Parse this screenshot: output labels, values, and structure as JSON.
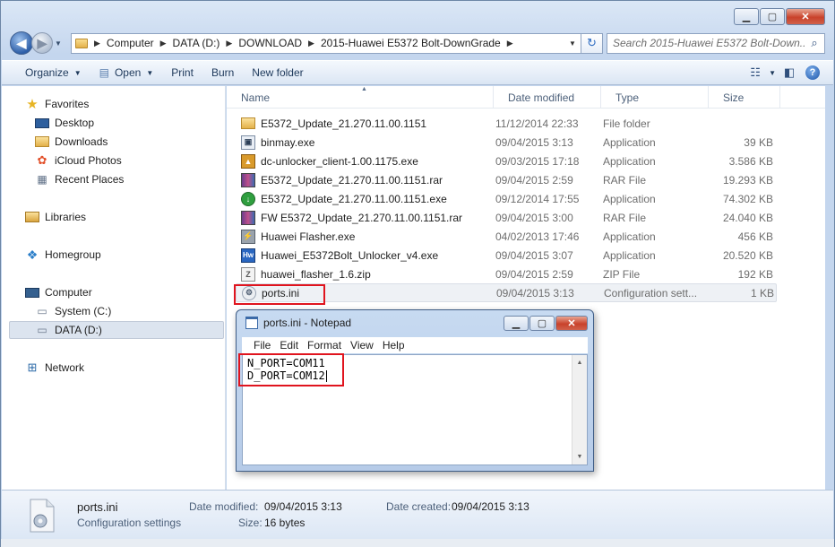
{
  "address": {
    "crumbs": [
      "Computer",
      "DATA (D:)",
      "DOWNLOAD",
      "2015-Huawei E5372 Bolt-DownGrade"
    ],
    "search_placeholder": "Search 2015-Huawei E5372 Bolt-Down..."
  },
  "toolbar": {
    "organize": "Organize",
    "open": "Open",
    "print": "Print",
    "burn": "Burn",
    "new_folder": "New folder"
  },
  "nav": {
    "favorites": "Favorites",
    "desktop": "Desktop",
    "downloads": "Downloads",
    "icloud": "iCloud Photos",
    "recent": "Recent Places",
    "libraries": "Libraries",
    "homegroup": "Homegroup",
    "computer": "Computer",
    "system": "System (C:)",
    "data": "DATA (D:)",
    "network": "Network"
  },
  "columns": {
    "name": "Name",
    "date": "Date modified",
    "type": "Type",
    "size": "Size"
  },
  "files": [
    {
      "name": "E5372_Update_21.270.11.00.1151",
      "date": "11/12/2014 22:33",
      "type": "File folder",
      "size": "",
      "icon": "folder-icon"
    },
    {
      "name": "binmay.exe",
      "date": "09/04/2015 3:13",
      "type": "Application",
      "size": "39 KB",
      "icon": "exe-icon"
    },
    {
      "name": "dc-unlocker_client-1.00.1175.exe",
      "date": "09/03/2015 17:18",
      "type": "Application",
      "size": "3.586 KB",
      "icon": "dc-unlocker-icon"
    },
    {
      "name": "E5372_Update_21.270.11.00.1151.rar",
      "date": "09/04/2015 2:59",
      "type": "RAR File",
      "size": "19.293 KB",
      "icon": "rar-icon"
    },
    {
      "name": "E5372_Update_21.270.11.00.1151.exe",
      "date": "09/12/2014 17:55",
      "type": "Application",
      "size": "74.302 KB",
      "icon": "update-icon"
    },
    {
      "name": "FW E5372_Update_21.270.11.00.1151.rar",
      "date": "09/04/2015 3:00",
      "type": "RAR File",
      "size": "24.040 KB",
      "icon": "rar-icon"
    },
    {
      "name": "Huawei Flasher.exe",
      "date": "04/02/2013 17:46",
      "type": "Application",
      "size": "456 KB",
      "icon": "flasher-icon"
    },
    {
      "name": "Huawei_E5372Bolt_Unlocker_v4.exe",
      "date": "09/04/2015 3:07",
      "type": "Application",
      "size": "20.520 KB",
      "icon": "hw-icon"
    },
    {
      "name": "huawei_flasher_1.6.zip",
      "date": "09/04/2015 2:59",
      "type": "ZIP File",
      "size": "192 KB",
      "icon": "zip-icon"
    },
    {
      "name": "ports.ini",
      "date": "09/04/2015 3:13",
      "type": "Configuration sett...",
      "size": "1 KB",
      "icon": "ini-icon"
    }
  ],
  "notepad": {
    "title": "ports.ini - Notepad",
    "menu": [
      "File",
      "Edit",
      "Format",
      "View",
      "Help"
    ],
    "lines": [
      "N_PORT=COM11",
      "D_PORT=COM12"
    ]
  },
  "details": {
    "name": "ports.ini",
    "subtitle": "Configuration settings",
    "modified_label": "Date modified:",
    "modified": "09/04/2015 3:13",
    "created_label": "Date created:",
    "created": "09/04/2015 3:13",
    "size_label": "Size:",
    "size": "16 bytes"
  }
}
